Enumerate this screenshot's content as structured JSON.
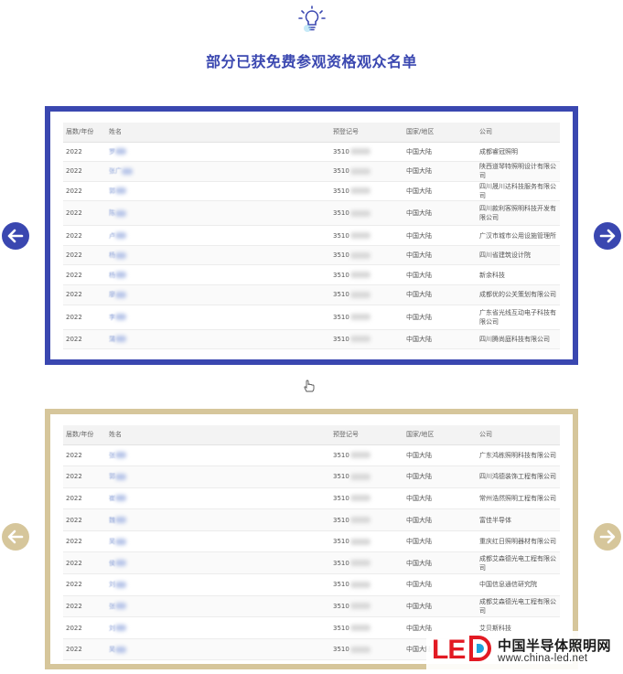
{
  "title": "部分已获免费参观资格观众名单",
  "icons": {
    "bulb": "lightbulb-icon",
    "prev": "arrow-left-icon",
    "next": "arrow-right-icon",
    "hand": "pointing-hand-icon"
  },
  "colors": {
    "blue": "#3a47b0",
    "gold": "#d6c69b",
    "logo_red": "#e21a23"
  },
  "columns": [
    "届数/年份",
    "姓名",
    "预登记号",
    "国家/地区",
    "公司"
  ],
  "blue_rows": [
    {
      "year": "2022",
      "name": "罗",
      "reg": "3510",
      "region": "中国大陆",
      "company": "成都睿冠照明",
      "tall": false
    },
    {
      "year": "2022",
      "name": "张广",
      "reg": "3510",
      "region": "中国大陆",
      "company": "陕西道琴特照明设计有限公司",
      "tall": false
    },
    {
      "year": "2022",
      "name": "郭",
      "reg": "3510",
      "region": "中国大陆",
      "company": "四川晟川达科技服务有限公司",
      "tall": false
    },
    {
      "year": "2022",
      "name": "陈",
      "reg": "3510",
      "region": "中国大陆",
      "company": "四川款利客照明科技开发有限公司",
      "tall": true
    },
    {
      "year": "2022",
      "name": "卢",
      "reg": "3510",
      "region": "中国大陆",
      "company": "广汉市城市公用设施管理所",
      "tall": false
    },
    {
      "year": "2022",
      "name": "杨",
      "reg": "3510",
      "region": "中国大陆",
      "company": "四川省建筑设计院",
      "tall": false
    },
    {
      "year": "2022",
      "name": "杨",
      "reg": "3510",
      "region": "中国大陆",
      "company": "新余科技",
      "tall": false
    },
    {
      "year": "2022",
      "name": "廖",
      "reg": "3510",
      "region": "中国大陆",
      "company": "成都优的公关策划有限公司",
      "tall": false
    },
    {
      "year": "2022",
      "name": "李",
      "reg": "3510",
      "region": "中国大陆",
      "company": "广东省光线互动电子科技有限公司",
      "tall": true
    },
    {
      "year": "2022",
      "name": "蒲",
      "reg": "3510",
      "region": "中国大陆",
      "company": "四川腾尚庭科技有限公司",
      "tall": false
    }
  ],
  "gold_rows": [
    {
      "year": "2022",
      "name": "张",
      "reg": "3510",
      "region": "中国大陆",
      "company": "广东鸿栋照明科技有限公司"
    },
    {
      "year": "2022",
      "name": "郭",
      "reg": "3510",
      "region": "中国大陆",
      "company": "四川鸿德装饰工程有限公司"
    },
    {
      "year": "2022",
      "name": "崔",
      "reg": "3510",
      "region": "中国大陆",
      "company": "常州浩然照明工程有限公司"
    },
    {
      "year": "2022",
      "name": "魏",
      "reg": "3510",
      "region": "中国大陆",
      "company": "富佳半导体"
    },
    {
      "year": "2022",
      "name": "吴",
      "reg": "3510",
      "region": "中国大陆",
      "company": "重庆红日照明器材有限公司"
    },
    {
      "year": "2022",
      "name": "侯",
      "reg": "3510",
      "region": "中国大陆",
      "company": "成都艾森德光电工程有限公司"
    },
    {
      "year": "2022",
      "name": "刘",
      "reg": "3510",
      "region": "中国大陆",
      "company": "中国信息通信研究院"
    },
    {
      "year": "2022",
      "name": "张",
      "reg": "3510",
      "region": "中国大陆",
      "company": "成都艾森德光电工程有限公司"
    },
    {
      "year": "2022",
      "name": "刘",
      "reg": "3510",
      "region": "中国大陆",
      "company": "艾贝斯科技"
    },
    {
      "year": "2022",
      "name": "吴",
      "reg": "3510",
      "region": "中国大陆",
      "company": ""
    }
  ],
  "logo": {
    "mark": "LE",
    "cn": "中国半导体照明网",
    "url": "www.china-led.net"
  }
}
